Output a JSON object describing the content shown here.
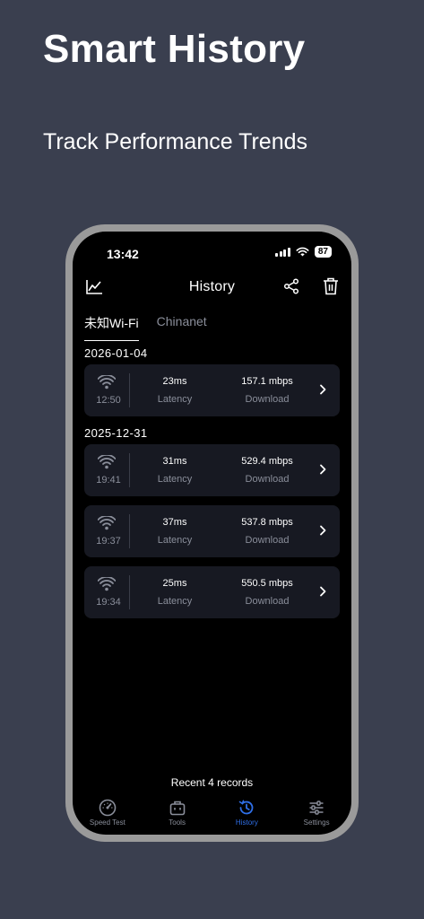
{
  "promo": {
    "title": "Smart History",
    "subtitle": "Track Performance Trends"
  },
  "status_bar": {
    "time": "13:42",
    "battery": "87"
  },
  "nav": {
    "title": "History",
    "left_icon": "chart-icon",
    "share_icon": "share-icon",
    "trash_icon": "trash-icon"
  },
  "tabs": [
    {
      "label": "未知Wi-Fi",
      "active": true
    },
    {
      "label": "Chinanet",
      "active": false
    }
  ],
  "groups": [
    {
      "date": "2026-01-04",
      "records": [
        {
          "time": "12:50",
          "latency": "23ms",
          "latency_label": "Latency",
          "download": "157.1 mbps",
          "download_label": "Download"
        }
      ]
    },
    {
      "date": "2025-12-31",
      "records": [
        {
          "time": "19:41",
          "latency": "31ms",
          "latency_label": "Latency",
          "download": "529.4 mbps",
          "download_label": "Download"
        },
        {
          "time": "19:37",
          "latency": "37ms",
          "latency_label": "Latency",
          "download": "537.8 mbps",
          "download_label": "Download"
        },
        {
          "time": "19:34",
          "latency": "25ms",
          "latency_label": "Latency",
          "download": "550.5 mbps",
          "download_label": "Download"
        }
      ]
    }
  ],
  "footer": {
    "recent_count": "Recent 4 records"
  },
  "tab_bar": [
    {
      "label": "Speed Test",
      "icon": "speedometer-icon",
      "active": false
    },
    {
      "label": "Tools",
      "icon": "toolbox-icon",
      "active": false
    },
    {
      "label": "History",
      "icon": "history-icon",
      "active": true
    },
    {
      "label": "Settings",
      "icon": "sliders-icon",
      "active": false
    }
  ],
  "colors": {
    "background": "#3a3f4f",
    "screen": "#000000",
    "card": "#171922",
    "accent": "#2f6fe8",
    "muted_text": "#8a8e9a"
  }
}
